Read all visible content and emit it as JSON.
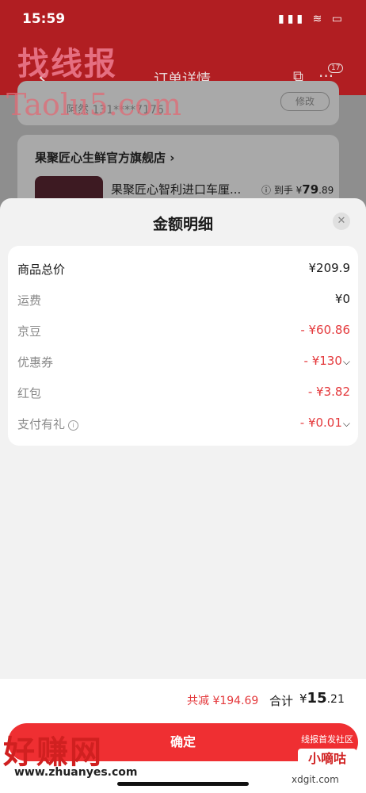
{
  "status_bar": {
    "time": "15:59",
    "icons": "▮▮▮ ≋ ▭"
  },
  "background": {
    "page_title": "订单详情",
    "badge": "17",
    "address_text": "阿然 131****7176",
    "modify_label": "修改",
    "shop_name": "果聚匠心生鲜官方旗舰店 ›",
    "product_name": "果聚匠心智利进口车厘...",
    "product_price_prefix": "ⓘ 到手 ¥",
    "product_price_int": "79",
    "product_price_dec": ".89"
  },
  "sheet": {
    "title": "金额明细",
    "close_icon": "close-icon",
    "rows": [
      {
        "label": "商品总价",
        "value": "¥209.9"
      },
      {
        "label": "运费",
        "value": "¥0"
      },
      {
        "label": "京豆",
        "value": "- ¥60.86"
      },
      {
        "label": "优惠券",
        "value": "- ¥130"
      },
      {
        "label": "红包",
        "value": "- ¥3.82"
      },
      {
        "label": "支付有礼",
        "value": "- ¥0.01"
      }
    ]
  },
  "footer": {
    "reduce_text": "共减 ¥194.69",
    "total_label": "合计",
    "total_currency": "¥",
    "total_int": "15",
    "total_dec": ".21",
    "confirm_label": "确定"
  },
  "watermarks": {
    "top_text": "找线报",
    "top_domain": "Taolu5.com",
    "bottom_text": "好赚网",
    "bottom_domain": "www.zhuanyes.com",
    "right_small": "线报首发社区",
    "right_box": "小嘀咕",
    "right_domain": "xdgit.com"
  },
  "colors": {
    "accent_red": "#e4393c",
    "confirm_red": "#ef2f32",
    "header_red": "#b11e22"
  }
}
